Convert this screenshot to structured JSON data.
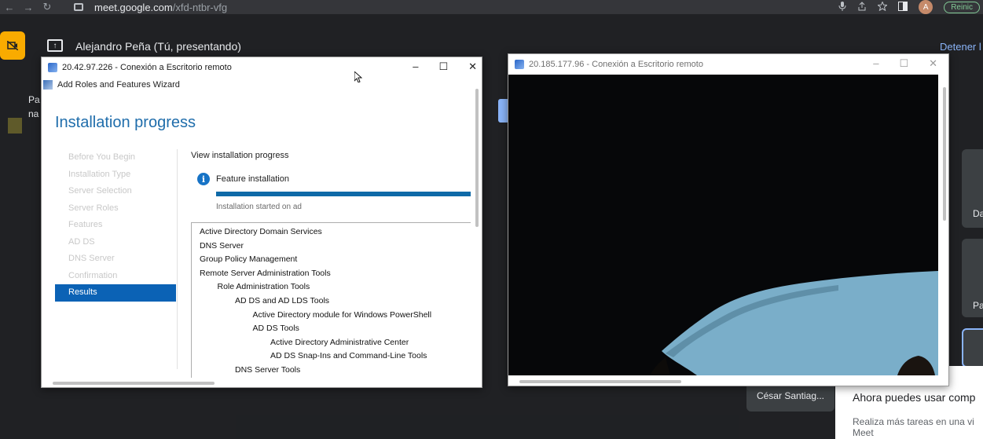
{
  "browser": {
    "url_host": "meet.google.com",
    "url_path": "/xfd-ntbr-vfg",
    "avatar_letter": "A",
    "restart_label": "Reinic",
    "nav": {
      "back": "←",
      "forward": "→",
      "reload": "↻"
    },
    "icons": [
      "mic-icon",
      "share-icon",
      "star-icon",
      "sidepanel-icon"
    ]
  },
  "meet": {
    "presenter": "Alejandro Peña (Tú, presentando)",
    "stop_presenting": "Detener l",
    "left_text_a": "Pa",
    "left_text_b": "na",
    "tile_da": "Da",
    "tile_pa": "Pa",
    "participant": "César Santiag...",
    "notice_title": "Ahora puedes usar comp",
    "notice_body": "Realiza más tareas en una vi",
    "notice_body2": "Meet",
    "colors": {
      "accent": "#8ab4f8",
      "camera_off": "#f9ab00",
      "background": "#202124"
    }
  },
  "rdp1": {
    "title": "20.42.97.226 - Conexión a Escritorio remoto",
    "wizard_title": "Add Roles and Features Wizard",
    "heading": "Installation progress",
    "steps": [
      {
        "label": "Before You Begin",
        "active": false
      },
      {
        "label": "Installation Type",
        "active": false
      },
      {
        "label": "Server Selection",
        "active": false
      },
      {
        "label": "Server Roles",
        "active": false
      },
      {
        "label": "Features",
        "active": false
      },
      {
        "label": "AD DS",
        "active": false
      },
      {
        "label": "DNS Server",
        "active": false
      },
      {
        "label": "Confirmation",
        "active": false
      },
      {
        "label": "Results",
        "active": true
      }
    ],
    "view_progress": "View installation progress",
    "feature_installation": "Feature installation",
    "progress": 1.0,
    "started": "Installation started on ad",
    "features": [
      {
        "label": "Active Directory Domain Services",
        "level": 0
      },
      {
        "label": "DNS Server",
        "level": 0
      },
      {
        "label": "Group Policy Management",
        "level": 0
      },
      {
        "label": "Remote Server Administration Tools",
        "level": 0
      },
      {
        "label": "Role Administration Tools",
        "level": 1
      },
      {
        "label": "AD DS and AD LDS Tools",
        "level": 2
      },
      {
        "label": "Active Directory module for Windows PowerShell",
        "level": 3
      },
      {
        "label": "AD DS Tools",
        "level": 3
      },
      {
        "label": "Active Directory Administrative Center",
        "level": 4
      },
      {
        "label": "AD DS Snap-Ins and Command-Line Tools",
        "level": 4
      },
      {
        "label": "DNS Server Tools",
        "level": 2
      }
    ]
  },
  "rdp2": {
    "title": "20.185.177.96 - Conexión a Escritorio remoto"
  },
  "window_buttons": {
    "minimize": "–",
    "maximize": "☐",
    "close": "✕"
  }
}
